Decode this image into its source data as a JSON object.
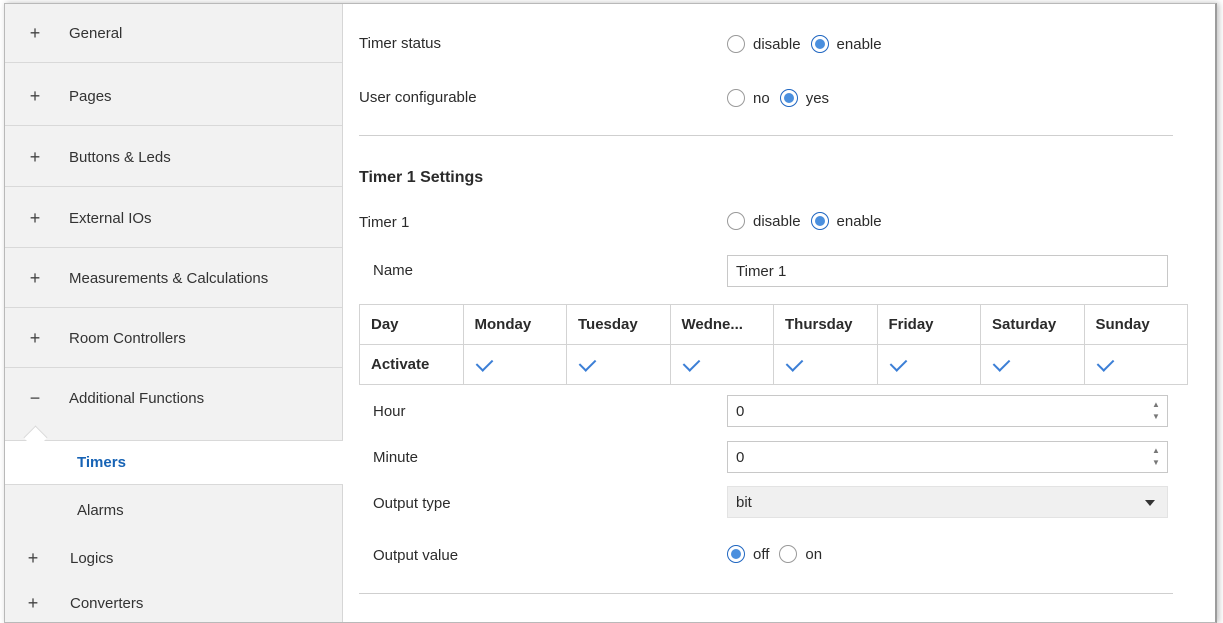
{
  "sidebar": {
    "items": [
      {
        "sign": "+",
        "label": "General"
      },
      {
        "sign": "+",
        "label": "Pages"
      },
      {
        "sign": "+",
        "label": "Buttons & Leds"
      },
      {
        "sign": "+",
        "label": "External IOs"
      },
      {
        "sign": "+",
        "label": "Measurements & Calculations"
      },
      {
        "sign": "+",
        "label": "Room Controllers"
      },
      {
        "sign": "−",
        "label": "Additional Functions"
      }
    ],
    "sub_items": [
      {
        "label": "Timers",
        "active": true
      },
      {
        "label": "Alarms",
        "active": false
      }
    ],
    "tail_items": [
      {
        "sign": "+",
        "label": "Logics"
      },
      {
        "sign": "+",
        "label": "Converters"
      }
    ]
  },
  "main": {
    "timer_status": {
      "label": "Timer status",
      "options": [
        "disable",
        "enable"
      ],
      "selected": "enable"
    },
    "user_configurable": {
      "label": "User configurable",
      "options": [
        "no",
        "yes"
      ],
      "selected": "yes"
    },
    "section_title": "Timer 1 Settings",
    "timer1": {
      "label": "Timer 1",
      "options": [
        "disable",
        "enable"
      ],
      "selected": "enable"
    },
    "name": {
      "label": "Name",
      "value": "Timer 1"
    },
    "day_table": {
      "row_header": "Day",
      "activate_label": "Activate",
      "days": [
        "Monday",
        "Tuesday",
        "Wedne...",
        "Thursday",
        "Friday",
        "Saturday",
        "Sunday"
      ],
      "activated": [
        true,
        true,
        true,
        true,
        true,
        true,
        true
      ]
    },
    "hour": {
      "label": "Hour",
      "value": "0"
    },
    "minute": {
      "label": "Minute",
      "value": "0"
    },
    "output_type": {
      "label": "Output type",
      "value": "bit"
    },
    "output_value": {
      "label": "Output value",
      "options": [
        "off",
        "on"
      ],
      "selected": "off"
    }
  },
  "colors": {
    "accent": "#1763b5",
    "radio_fill": "#4a8fde",
    "check": "#3c7fd6"
  }
}
